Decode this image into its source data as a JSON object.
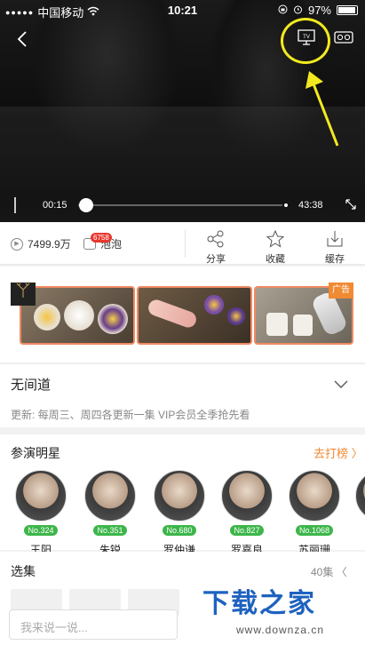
{
  "status": {
    "carrier": "中国移动",
    "time": "10:21",
    "battery": "97%"
  },
  "player": {
    "current_time": "00:15",
    "total_time": "43:38",
    "progress": 0.006
  },
  "actions": {
    "views": "7499.9万",
    "bubble_label": "泡泡",
    "bubble_badge": "6758",
    "share_label": "分享",
    "favorite_label": "收藏",
    "download_label": "缓存"
  },
  "ad": {
    "tag": "广告"
  },
  "show": {
    "title": "无间道",
    "update": "更新: 每周三、周四各更新一集 VIP会员全季抢先看"
  },
  "stars": {
    "heading": "参演明星",
    "rank_link": "去打榜 〉",
    "list": [
      {
        "name": "王阳",
        "rank": "No.324"
      },
      {
        "name": "朱锐",
        "rank": "No.351"
      },
      {
        "name": "罗仲谦",
        "rank": "No.680"
      },
      {
        "name": "罗嘉良",
        "rank": "No.827"
      },
      {
        "name": "苏丽珊",
        "rank": "No.1068"
      }
    ]
  },
  "episodes": {
    "heading": "选集",
    "more": "40集 〈"
  },
  "comment": {
    "placeholder": "我来说一说..."
  },
  "watermark": {
    "brand": "下载之家",
    "url": "www.downza.cn"
  },
  "colors": {
    "accent_orange": "#f08a33",
    "rank_green": "#3cb64a",
    "annotation_yellow": "#f2ea1e",
    "badge_red": "#e8382f"
  }
}
